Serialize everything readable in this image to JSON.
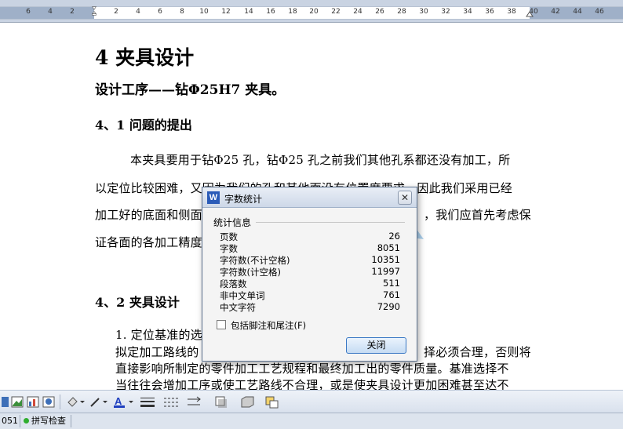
{
  "ruler": {
    "numbers": [
      "6",
      "4",
      "2",
      "2",
      "4",
      "6",
      "8",
      "10",
      "12",
      "14",
      "16",
      "18",
      "20",
      "22",
      "24",
      "26",
      "28",
      "30",
      "32",
      "34",
      "36",
      "38",
      "40",
      "42",
      "44",
      "46"
    ]
  },
  "document": {
    "chapter_heading": "4 夹具设计",
    "subtitle": "设计工序——钻Φ25H7 夹具。",
    "section1_heading": "4、1 问题的提出",
    "para1_lines": [
      "本夹具要用于钻Φ25 孔，钻Φ25 孔之前我们其他孔系都还没有加工，所",
      "以定位比较困难，又因为我们的孔和其他面没有位置度要求，因此我们采用已经",
      "加工好的底面和侧面",
      "，我们应首先考虑保",
      "证各面的各加工精度"
    ],
    "section2_heading": "4、2 夹具设计",
    "list_item_1": "1. 定位基准的选",
    "para2_lines": [
      "拟定加工路线的",
      "择必须合理，否则将",
      "直接影响所制定的零件加工工艺规程和最终加工出的零件质量。基准选择不",
      "当往往会增加工序或使工艺路线不合理，或是使夹具设计更加困难甚至达不"
    ]
  },
  "dialog": {
    "title": "字数统计",
    "close_glyph": "✕",
    "group_label": "统计信息",
    "stats": [
      {
        "label": "页数",
        "value": "26"
      },
      {
        "label": "字数",
        "value": "8051"
      },
      {
        "label": "字符数(不计空格)",
        "value": "10351"
      },
      {
        "label": "字符数(计空格)",
        "value": "11997"
      },
      {
        "label": "段落数",
        "value": "511"
      },
      {
        "label": "非中文单词",
        "value": "761"
      },
      {
        "label": "中文字符",
        "value": "7290"
      }
    ],
    "checkbox_label": "包括脚注和尾注(F)",
    "close_button": "关闭"
  },
  "statusbar": {
    "word_count_fragment": "051",
    "spell_check": "拼写检查"
  },
  "colors": {
    "accent": "#2a5bb8",
    "status_ok": "#2fae2f",
    "font_color_a": "#1f3fbf"
  }
}
